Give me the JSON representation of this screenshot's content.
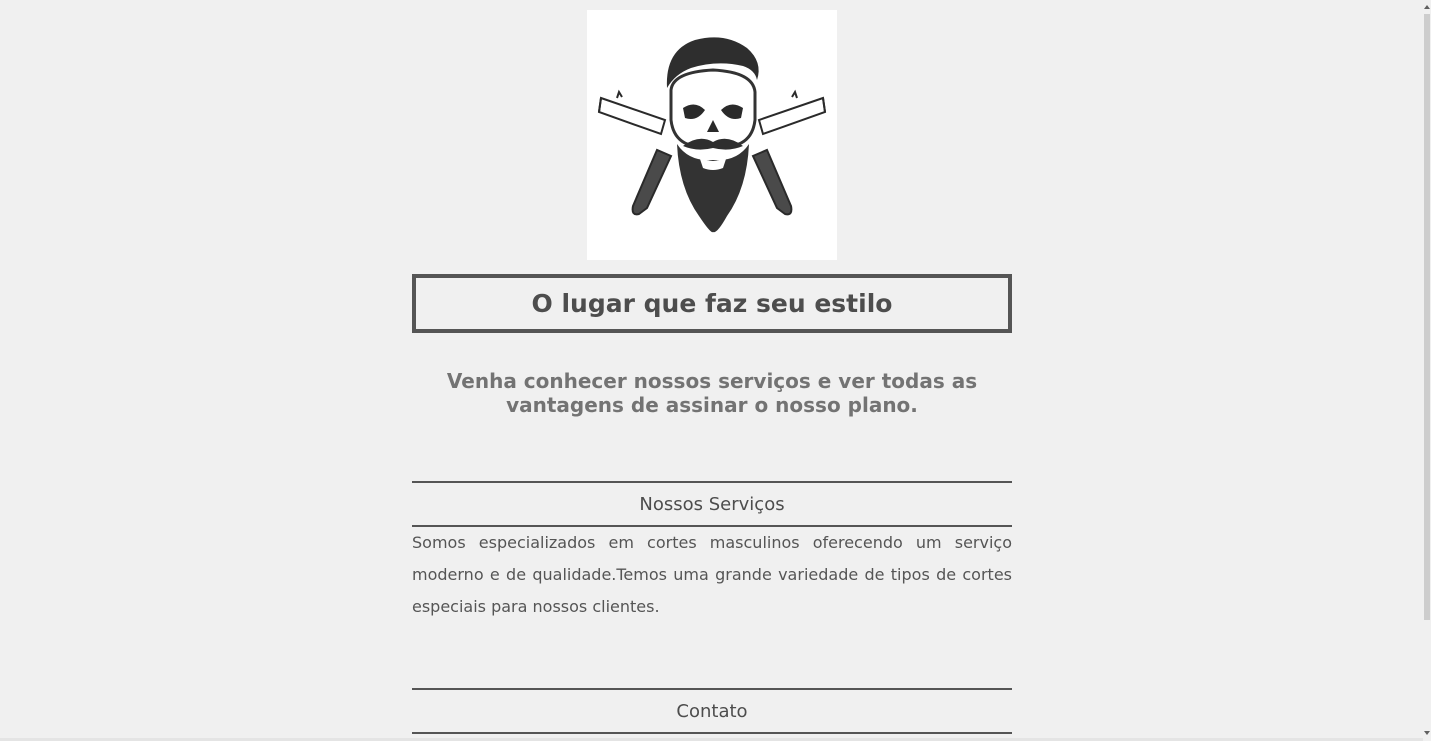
{
  "logo": {
    "icon": "bearded-skull-crossed-razors-icon"
  },
  "hero": {
    "title": "O lugar que faz seu estilo",
    "tagline": "Venha conhecer nossos serviços e ver todas as vantagens de assinar o nosso plano."
  },
  "services": {
    "heading": "Nossos Serviços",
    "text": "Somos especializados em cortes masculinos oferecendo um serviço moderno e de qualidade.Temos uma grande variedade de tipos de cortes especiais para nossos clientes."
  },
  "contact": {
    "heading": "Contato"
  },
  "colors": {
    "background": "#f0f0f0",
    "border": "#555555",
    "text": "#4d4d4d",
    "tagline": "#737373"
  }
}
